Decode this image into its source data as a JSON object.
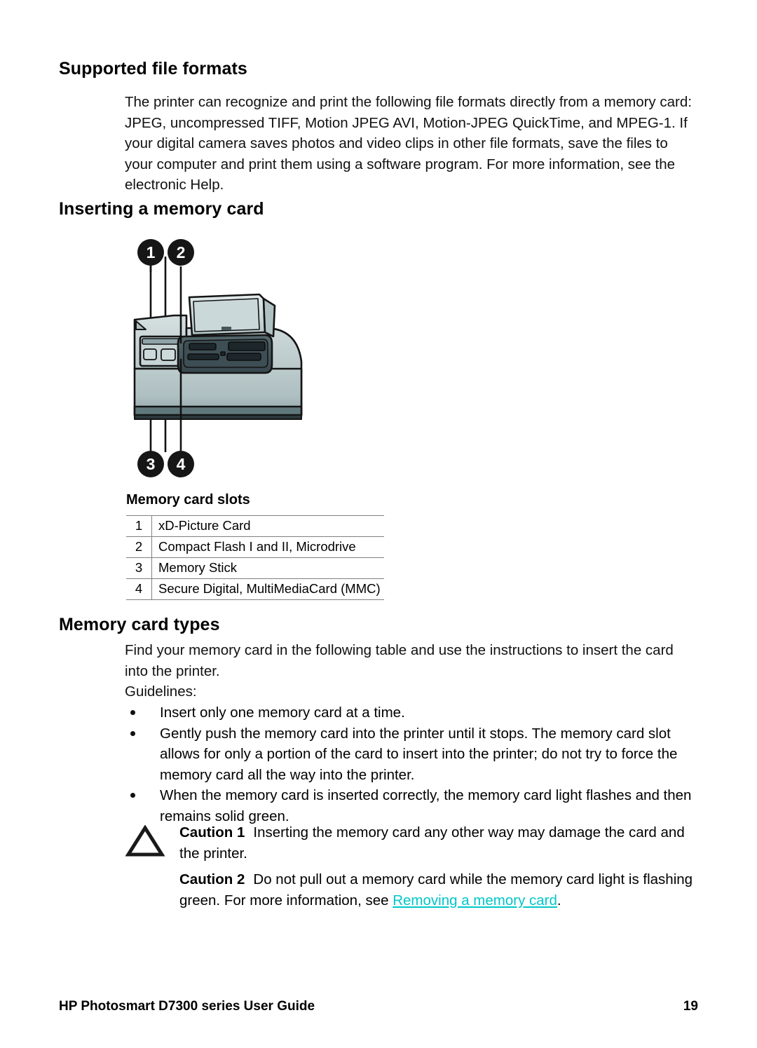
{
  "document": {
    "sections": [
      {
        "heading": "Supported file formats",
        "paragraphs": [
          "The printer can recognize and print the following file formats directly from a memory card: JPEG, uncompressed TIFF, Motion JPEG AVI, Motion-JPEG QuickTime, and MPEG-1. If your digital camera saves photos and video clips in other file formats, save the files to your computer and print them using a software program. For more information, see the electronic Help."
        ]
      },
      {
        "heading": "Inserting a memory card"
      },
      {
        "heading": "Memory card types",
        "paragraphs": [
          "Find your memory card in the following table and use the instructions to insert the card into the printer.",
          "Guidelines:"
        ]
      }
    ]
  },
  "figure": {
    "alt_name": "printer-memory-card-slots-illustration",
    "callouts": [
      {
        "number": "1"
      },
      {
        "number": "2"
      },
      {
        "number": "3"
      },
      {
        "number": "4"
      }
    ],
    "colors": {
      "body_light": "#c3d0d1",
      "body_mid": "#a9bbbd",
      "body_dark": "#5b7277",
      "outline": "#1a1a1a",
      "slot_dark": "#2e3b40",
      "callout_fill": "#161616",
      "callout_text": "#ffffff"
    }
  },
  "slots_table": {
    "title": "Memory card slots",
    "rows": [
      {
        "num": "1",
        "desc": "xD-Picture Card"
      },
      {
        "num": "2",
        "desc": "Compact Flash I and II, Microdrive"
      },
      {
        "num": "3",
        "desc": "Memory Stick"
      },
      {
        "num": "4",
        "desc": "Secure Digital, MultiMediaCard (MMC)"
      }
    ]
  },
  "guidelines": {
    "bullets": [
      "Insert only one memory card at a time.",
      "Gently push the memory card into the printer until it stops. The memory card slot allows for only a portion of the card to insert into the printer; do not try to force the memory card all the way into the printer.",
      "When the memory card is inserted correctly, the memory card light flashes and then remains solid green."
    ]
  },
  "cautions": [
    {
      "label": "Caution 1",
      "text": "Inserting the memory card any other way may damage the card and the printer.",
      "has_icon": true
    },
    {
      "label": "Caution 2",
      "text_before_link": "Do not pull out a memory card while the memory card light is flashing green. For more information, see ",
      "link_text": "Removing a memory card",
      "text_after_link": ".",
      "has_icon": false
    }
  ],
  "footer": {
    "title": "HP Photosmart D7300 series User Guide",
    "page_number": "19"
  },
  "colors": {
    "link": "#00c6c9",
    "text": "#111111",
    "rule": "#808080"
  }
}
